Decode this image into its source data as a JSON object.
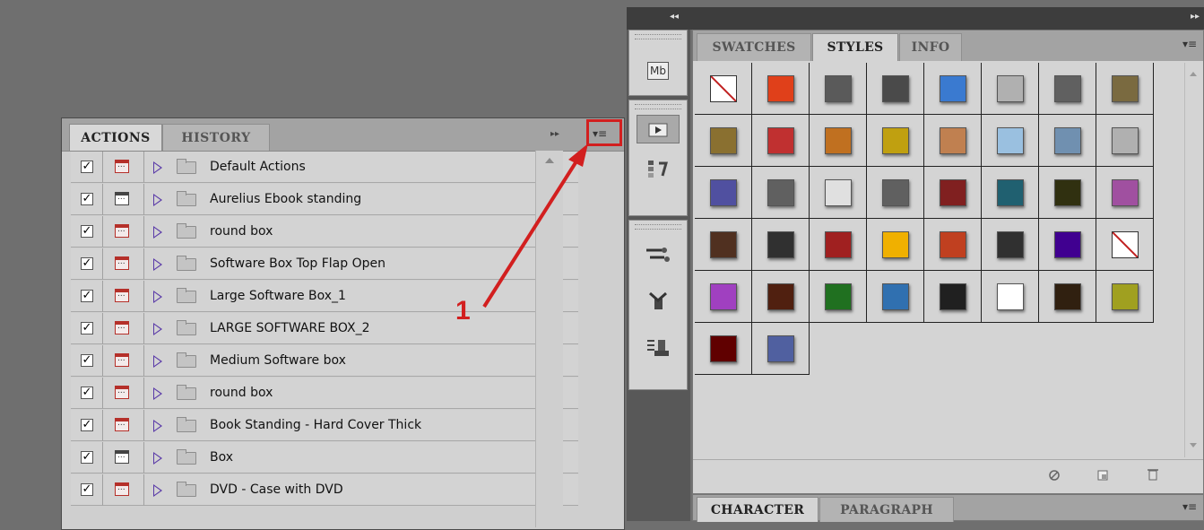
{
  "actions_panel": {
    "tabs": [
      "ACTIONS",
      "HISTORY"
    ],
    "collapse_glyph": "▸▸",
    "menu_glyph": "▾≡",
    "rows": [
      {
        "label": "Default Actions",
        "checked": true,
        "dialog": "red"
      },
      {
        "label": "Aurelius Ebook standing",
        "checked": true,
        "dialog": "gray"
      },
      {
        "label": "round box",
        "checked": true,
        "dialog": "red"
      },
      {
        "label": "Software Box Top Flap Open",
        "checked": true,
        "dialog": "red"
      },
      {
        "label": "Large Software Box_1",
        "checked": true,
        "dialog": "red"
      },
      {
        "label": "LARGE SOFTWARE BOX_2",
        "checked": true,
        "dialog": "red"
      },
      {
        "label": "Medium Software box",
        "checked": true,
        "dialog": "red"
      },
      {
        "label": "round box",
        "checked": true,
        "dialog": "red"
      },
      {
        "label": "Book Standing - Hard Cover Thick",
        "checked": true,
        "dialog": "red"
      },
      {
        "label": "Box",
        "checked": true,
        "dialog": "gray"
      },
      {
        "label": "DVD - Case with DVD",
        "checked": true,
        "dialog": "red"
      }
    ]
  },
  "annotation": {
    "number": "1",
    "color": "#d21f1f"
  },
  "dock": {
    "top_arrows": "◂◂",
    "buttons": [
      "mini-bridge-icon",
      "actions-play-icon",
      "history-icon",
      "brushes-icon",
      "clone-source-icon",
      "tool-presets-icon"
    ],
    "mini_bridge_text": "Mb"
  },
  "styles_panel": {
    "top_arrows": "▸▸",
    "tabs": [
      "SWATCHES",
      "STYLES",
      "INFO"
    ],
    "active_tab": "STYLES",
    "menu_glyph": "▾≡",
    "footer_icons": [
      "clear-style-icon",
      "new-style-icon",
      "delete-style-icon"
    ],
    "swatch_colors": [
      [
        "none",
        "#e0401a",
        "#5a5a5a",
        "#4a4a4a",
        "#3a7ad0",
        "#b0b0b0",
        "#606060",
        "#7a6a40"
      ],
      [
        "#8a7030",
        "#c03030",
        "#c07020",
        "#c0a010",
        "#c08050",
        "#9ac0e0",
        "#7090b0",
        "#b0b0b0"
      ],
      [
        "#5050a0",
        "#606060",
        "#e0e0e0",
        "#606060",
        "#802020",
        "#206070",
        "#303010",
        "#a050a0"
      ],
      [
        "#503020",
        "#303030",
        "#a02020",
        "#f0b000",
        "#c04020",
        "#303030",
        "#400090",
        "none"
      ],
      [
        "#a040c0",
        "#502010",
        "#207020",
        "#3070b0",
        "#202020",
        "#ffffff",
        "#302010",
        "#a0a020"
      ],
      [
        "#600000",
        "#5060a0"
      ]
    ]
  },
  "character_panel": {
    "tabs": [
      "CHARACTER",
      "PARAGRAPH"
    ],
    "menu_glyph": "▾≡"
  }
}
